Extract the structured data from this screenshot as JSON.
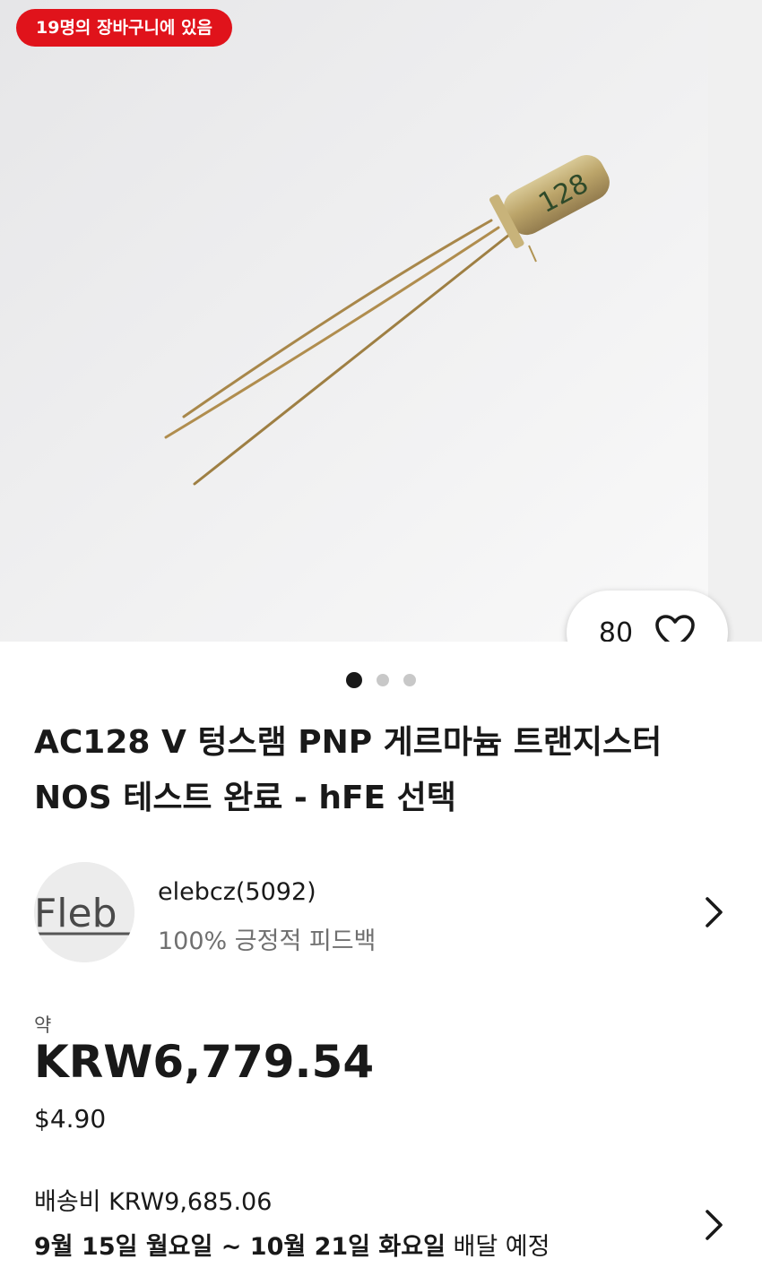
{
  "gallery": {
    "watchers_badge": "19명의 장바구니에 있음",
    "watch_count": "80",
    "page_count": 3,
    "active_page": 1,
    "photo_marking": "128"
  },
  "listing": {
    "title": "AC128 V 텅스램 PNP 게르마늄 트랜지스터 NOS 테스트 완료 - hFE 선택"
  },
  "seller": {
    "avatar_text": "Fleb",
    "name": "elebcz(5092)",
    "feedback": "100% 긍정적 피드백"
  },
  "price": {
    "approx_label": "약",
    "amount": "KRW6,779.54",
    "original": "$4.90"
  },
  "shipping": {
    "cost": "배송비 KRW9,685.06",
    "delivery_dates": "9월 15일 월요일 ~ 10월 21일 화요일",
    "delivery_suffix": "배달 예정"
  },
  "colors": {
    "badge_red": "#e0131b",
    "text_primary": "#191919",
    "text_secondary": "#707070"
  }
}
